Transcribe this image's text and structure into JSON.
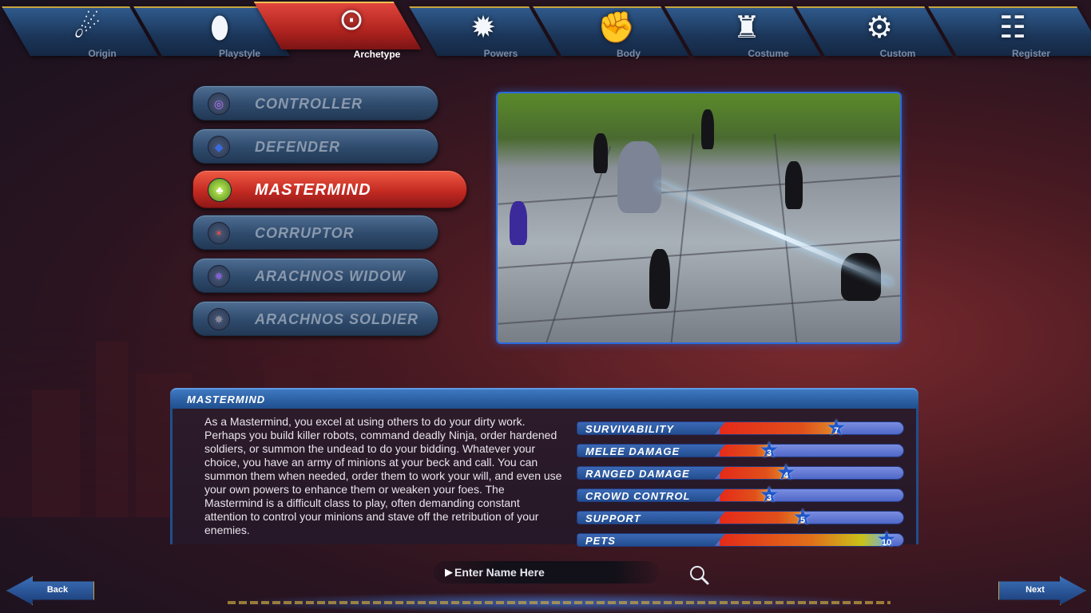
{
  "nav": {
    "tabs": [
      {
        "label": "Origin",
        "icon": "origin-icon",
        "glyph": "☄"
      },
      {
        "label": "Playstyle",
        "icon": "mouse-icon",
        "glyph": "⬮"
      },
      {
        "label": "Archetype",
        "icon": "mask-icon",
        "glyph": "⊙"
      },
      {
        "label": "Powers",
        "icon": "starburst-icon",
        "glyph": "✹"
      },
      {
        "label": "Body",
        "icon": "arm-icon",
        "glyph": "✊"
      },
      {
        "label": "Costume",
        "icon": "helmet-icon",
        "glyph": "♜"
      },
      {
        "label": "Custom",
        "icon": "gear-icon",
        "glyph": "⚙"
      },
      {
        "label": "Register",
        "icon": "document-icon",
        "glyph": "☷"
      }
    ],
    "active": "Archetype"
  },
  "archetypes": [
    {
      "label": "Controller",
      "icon_color": "#9a3fd0",
      "glyph": "◎"
    },
    {
      "label": "Defender",
      "icon_color": "#2a50c0",
      "glyph": "◆"
    },
    {
      "label": "Mastermind",
      "icon_color": "#7ac02a",
      "glyph": "♣"
    },
    {
      "label": "Corruptor",
      "icon_color": "#a03838",
      "glyph": "✶"
    },
    {
      "label": "Arachnos Widow",
      "icon_color": "#4a3a80",
      "glyph": "✸"
    },
    {
      "label": "Arachnos Soldier",
      "icon_color": "#3a3a4a",
      "glyph": "✸"
    }
  ],
  "selected_archetype": "Mastermind",
  "info": {
    "title": "MASTERMIND",
    "description": "As a Mastermind, you excel at using others to do your dirty work. Perhaps you build killer robots, command deadly Ninja, order hardened soldiers, or summon the undead to do your bidding. Whatever your choice, you have an army of minions at your beck and call. You can summon them when needed, order them to work your will, and even use your own powers to enhance them or weaken your foes. The Mastermind is a difficult class to play, often demanding constant attention to control your minions and stave off the retribution of your enemies."
  },
  "stats": [
    {
      "label": "Survivability",
      "value": "7",
      "fraction": 0.7
    },
    {
      "label": "Melee Damage",
      "value": "3",
      "fraction": 0.3
    },
    {
      "label": "Ranged Damage",
      "value": "4",
      "fraction": 0.4
    },
    {
      "label": "Crowd Control",
      "value": "3",
      "fraction": 0.3
    },
    {
      "label": "Support",
      "value": "5",
      "fraction": 0.5
    },
    {
      "label": "Pets",
      "value": "10",
      "fraction": 1.0
    }
  ],
  "name_input": {
    "placeholder": "Enter Name Here"
  },
  "buttons": {
    "back": "Back",
    "next": "Next"
  }
}
